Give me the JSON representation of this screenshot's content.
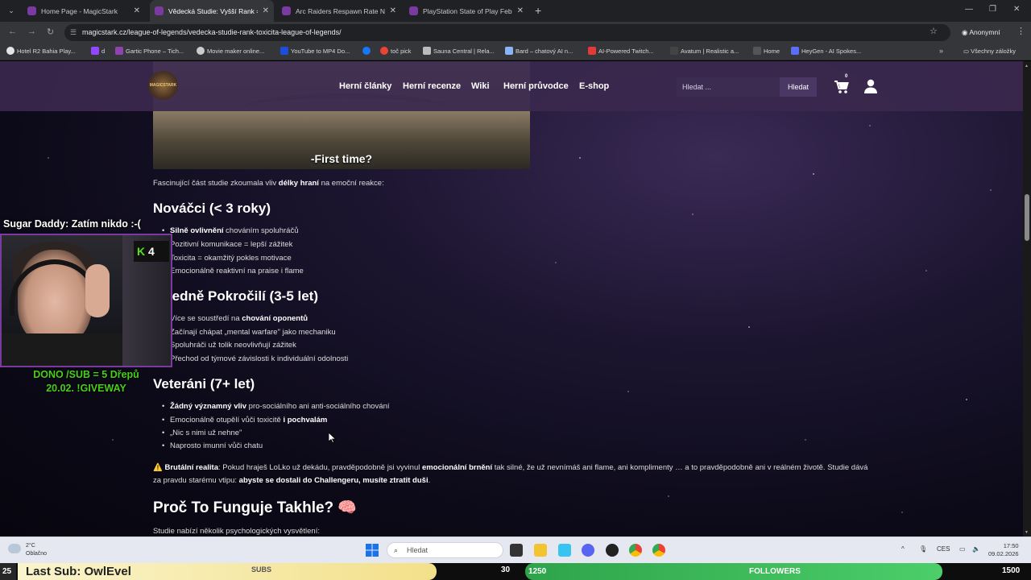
{
  "browser": {
    "tabs": [
      {
        "title": "Home Page - MagicStark"
      },
      {
        "title": "Vědecká Studie: Vyšší Rank = V"
      },
      {
        "title": "Arc Raiders Respawn Rate Nep"
      },
      {
        "title": "PlayStation State of Play Februa"
      }
    ],
    "url": "magicstark.cz/league-of-legends/vedecka-studie-rank-toxicita-league-of-legends/",
    "profile": "Anonymní",
    "bookmarks": [
      "Hotel R2 Bahia Play...",
      "d",
      "Gartic Phone – Tich...",
      "Movie maker online...",
      "YouTube to MP4 Do...",
      "",
      "toč pick",
      "Sauna Central | Rela...",
      "Bard – chatový AI n...",
      "AI-Powered Twitch...",
      "Avatum | Realistic a...",
      "Home",
      "HeyGen - AI Spokes..."
    ],
    "bookmarks_all": "Všechny záložky"
  },
  "site": {
    "logo": "MAGICSTARK",
    "nav": [
      "Herní články",
      "Herní recenze",
      "Wiki",
      "Herní průvodce",
      "E-shop"
    ],
    "search_placeholder": "Hledat ...",
    "search_button": "Hledat",
    "cart_count": "0"
  },
  "article": {
    "image_caption": "-First time?",
    "intro": [
      "Fascinující část studie zkoumala vliv ",
      "délky hraní",
      " na emoční reakce:"
    ],
    "sections": [
      {
        "heading": "Nováčci (< 3 roky)",
        "items": [
          [
            "",
            "Silně ovlivnění",
            " chováním spoluhráčů"
          ],
          [
            "Pozitivní komunikace = lepší zážitek"
          ],
          [
            "Toxicita = okamžitý pokles motivace"
          ],
          [
            "Emocionálně reaktivní na praise i flame"
          ]
        ]
      },
      {
        "heading": "Středně Pokročilí (3-5 let)",
        "items": [
          [
            "Více se soustředí na ",
            "chování oponentů",
            ""
          ],
          [
            "Začínají chápat „mental warfare\" jako mechaniku"
          ],
          [
            "Spoluhráči už tolik neovlivňují zážitek"
          ],
          [
            "Přechod od týmové závislosti k individuální odolnosti"
          ]
        ]
      },
      {
        "heading": "Veteráni (7+ let)",
        "items": [
          [
            "",
            "Žádný významný vliv",
            " pro-sociálního ani anti-sociálního chování"
          ],
          [
            "Emocionálně otupělí vůči toxicitě ",
            "i pochvalám",
            ""
          ],
          [
            "„Nic s nimi už nehne\""
          ],
          [
            "Naprosto imunní vůči chatu"
          ]
        ]
      }
    ],
    "reality": {
      "icon": "⚠️",
      "label": "Brutální realita",
      "t1": ": Pokud hraješ LoLko už dekádu, pravděpodobně jsi vyvinul ",
      "b1": "emocionální brnění",
      "t2": " tak silné, že už nevnímáš ani flame, ani komplimenty … a to pravděpodobně ani v reálném životě. Studie dává za pravdu starému vtipu: ",
      "b2": "abyste se dostali do Challengeru, musíte ztratit duši",
      "t3": "."
    },
    "h2_next": "Proč To Funguje Takhle?",
    "h2_emoji": "🧠",
    "last_line": "Studie nabízí několik psychologických vysvětlení:"
  },
  "stream_overlay": {
    "sugar_daddy": "Sugar Daddy: Zatím nikdo :-(",
    "kick_count": "4",
    "promo_line1": "DONO /SUB = 5 Dřepů",
    "promo_line2": "20.02. !GIVEWAY",
    "left_counter": "25",
    "last_sub": "Last Sub: OwlEvel",
    "subs_label": "SUBS",
    "subs_value": "30",
    "followers_current": "1250",
    "followers_label": "FOLLOWERS",
    "followers_goal": "1500"
  },
  "taskbar": {
    "temp": "2°C",
    "weather": "Oblačno",
    "search": "Hledat",
    "lang": "CES",
    "time": "17:50",
    "date": "09.02.2026"
  },
  "colors": {
    "header": "#3a284e",
    "accent": "#7a3aa0",
    "promo_green": "#47d01a"
  }
}
